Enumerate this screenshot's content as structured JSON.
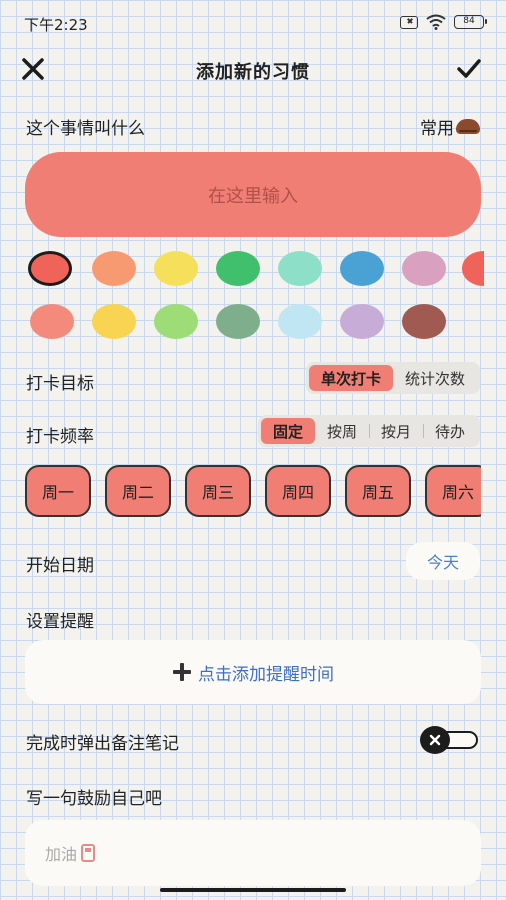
{
  "status_bar": {
    "time": "下午2:23",
    "battery": "84"
  },
  "header": {
    "title": "添加新的习惯"
  },
  "name_section": {
    "label": "这个事情叫什么",
    "frequent_label": "常用",
    "input_placeholder": "在这里输入"
  },
  "colors": {
    "row1": [
      "#f0635a",
      "#f79a72",
      "#f6df5a",
      "#40c06c",
      "#8edfc8",
      "#4aa2d4",
      "#daa0bf",
      "#f0635a"
    ],
    "row2": [
      "#f48a7c",
      "#f8d452",
      "#9edc78",
      "#7fae8c",
      "#bfe6f2",
      "#c8acd8",
      "#a05a52"
    ],
    "selected_index": 0
  },
  "goal": {
    "label": "打卡目标",
    "options": [
      "单次打卡",
      "统计次数"
    ],
    "active_index": 0
  },
  "frequency": {
    "label": "打卡频率",
    "options": [
      "固定",
      "按周",
      "按月",
      "待办"
    ],
    "active_index": 0
  },
  "days": [
    "周一",
    "周二",
    "周三",
    "周四",
    "周五",
    "周六"
  ],
  "start_date": {
    "label": "开始日期",
    "value": "今天"
  },
  "reminder": {
    "label": "设置提醒",
    "button_label": "点击添加提醒时间"
  },
  "note_popup": {
    "label": "完成时弹出备注笔记",
    "enabled": false
  },
  "motto": {
    "label": "写一句鼓励自己吧",
    "placeholder": "加油"
  }
}
